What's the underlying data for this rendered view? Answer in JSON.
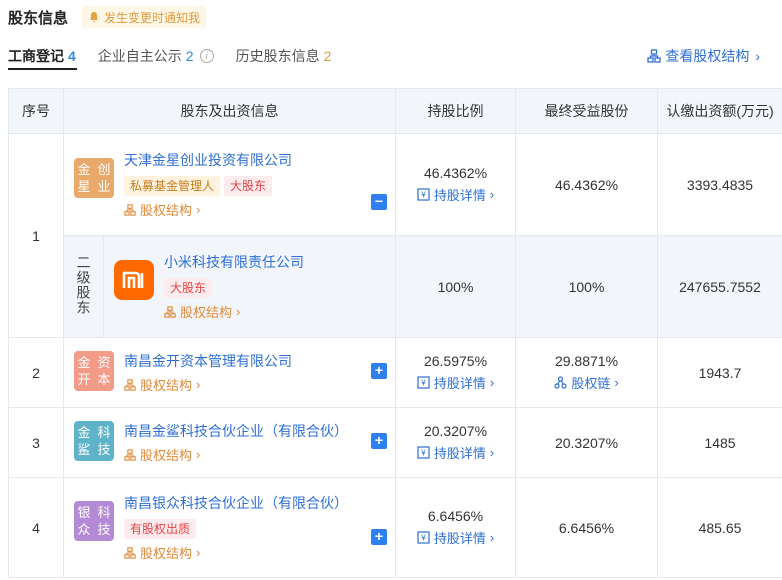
{
  "header": {
    "title": "股东信息",
    "notify_label": "发生变更时通知我"
  },
  "tabs": [
    {
      "label": "工商登记",
      "count": "4"
    },
    {
      "label": "企业自主公示",
      "count": "2"
    },
    {
      "label": "历史股东信息",
      "count": "2"
    }
  ],
  "struct_link": "查看股权结构",
  "table": {
    "headers": [
      "序号",
      "股东及出资信息",
      "持股比例",
      "最终受益股份",
      "认缴出资额(万元)"
    ],
    "struct_label": "股权结构",
    "detail_label": "持股详情",
    "chain_label": "股权链",
    "rows": [
      {
        "seq": "1",
        "logo": "金星创业",
        "name": "天津金星创业投资有限公司",
        "tags": [
          "私募基金管理人",
          "大股东"
        ],
        "ratio": "46.4362%",
        "benefit": "46.4362%",
        "capital": "3393.4835",
        "toggle": "−"
      },
      {
        "sub_label": "二级股东",
        "logo": "mi",
        "name": "小米科技有限责任公司",
        "tags": [
          "大股东"
        ],
        "ratio": "100%",
        "benefit": "100%",
        "capital": "247655.7552"
      },
      {
        "seq": "2",
        "logo": "金开资本",
        "name": "南昌金开资本管理有限公司",
        "ratio": "26.5975%",
        "benefit": "29.8871%",
        "capital": "1943.7",
        "toggle": "+"
      },
      {
        "seq": "3",
        "logo": "金鲨科技",
        "name": "南昌金鲨科技合伙企业（有限合伙）",
        "ratio": "20.3207%",
        "benefit": "20.3207%",
        "capital": "1485",
        "toggle": "+"
      },
      {
        "seq": "4",
        "logo": "银众科技",
        "name": "南昌银众科技合伙企业（有限合伙）",
        "tags": [
          "有股权出质"
        ],
        "ratio": "6.6456%",
        "benefit": "6.6456%",
        "capital": "485.65",
        "toggle": "+"
      }
    ]
  },
  "colors": {
    "link": "#2e6fd6",
    "accent": "#2e7ff0",
    "logo1": "#e8a96b",
    "logo2": "#f29b87",
    "logo3": "#5fb3c9",
    "logo4": "#b48ad6",
    "mi": "#ff6900"
  }
}
